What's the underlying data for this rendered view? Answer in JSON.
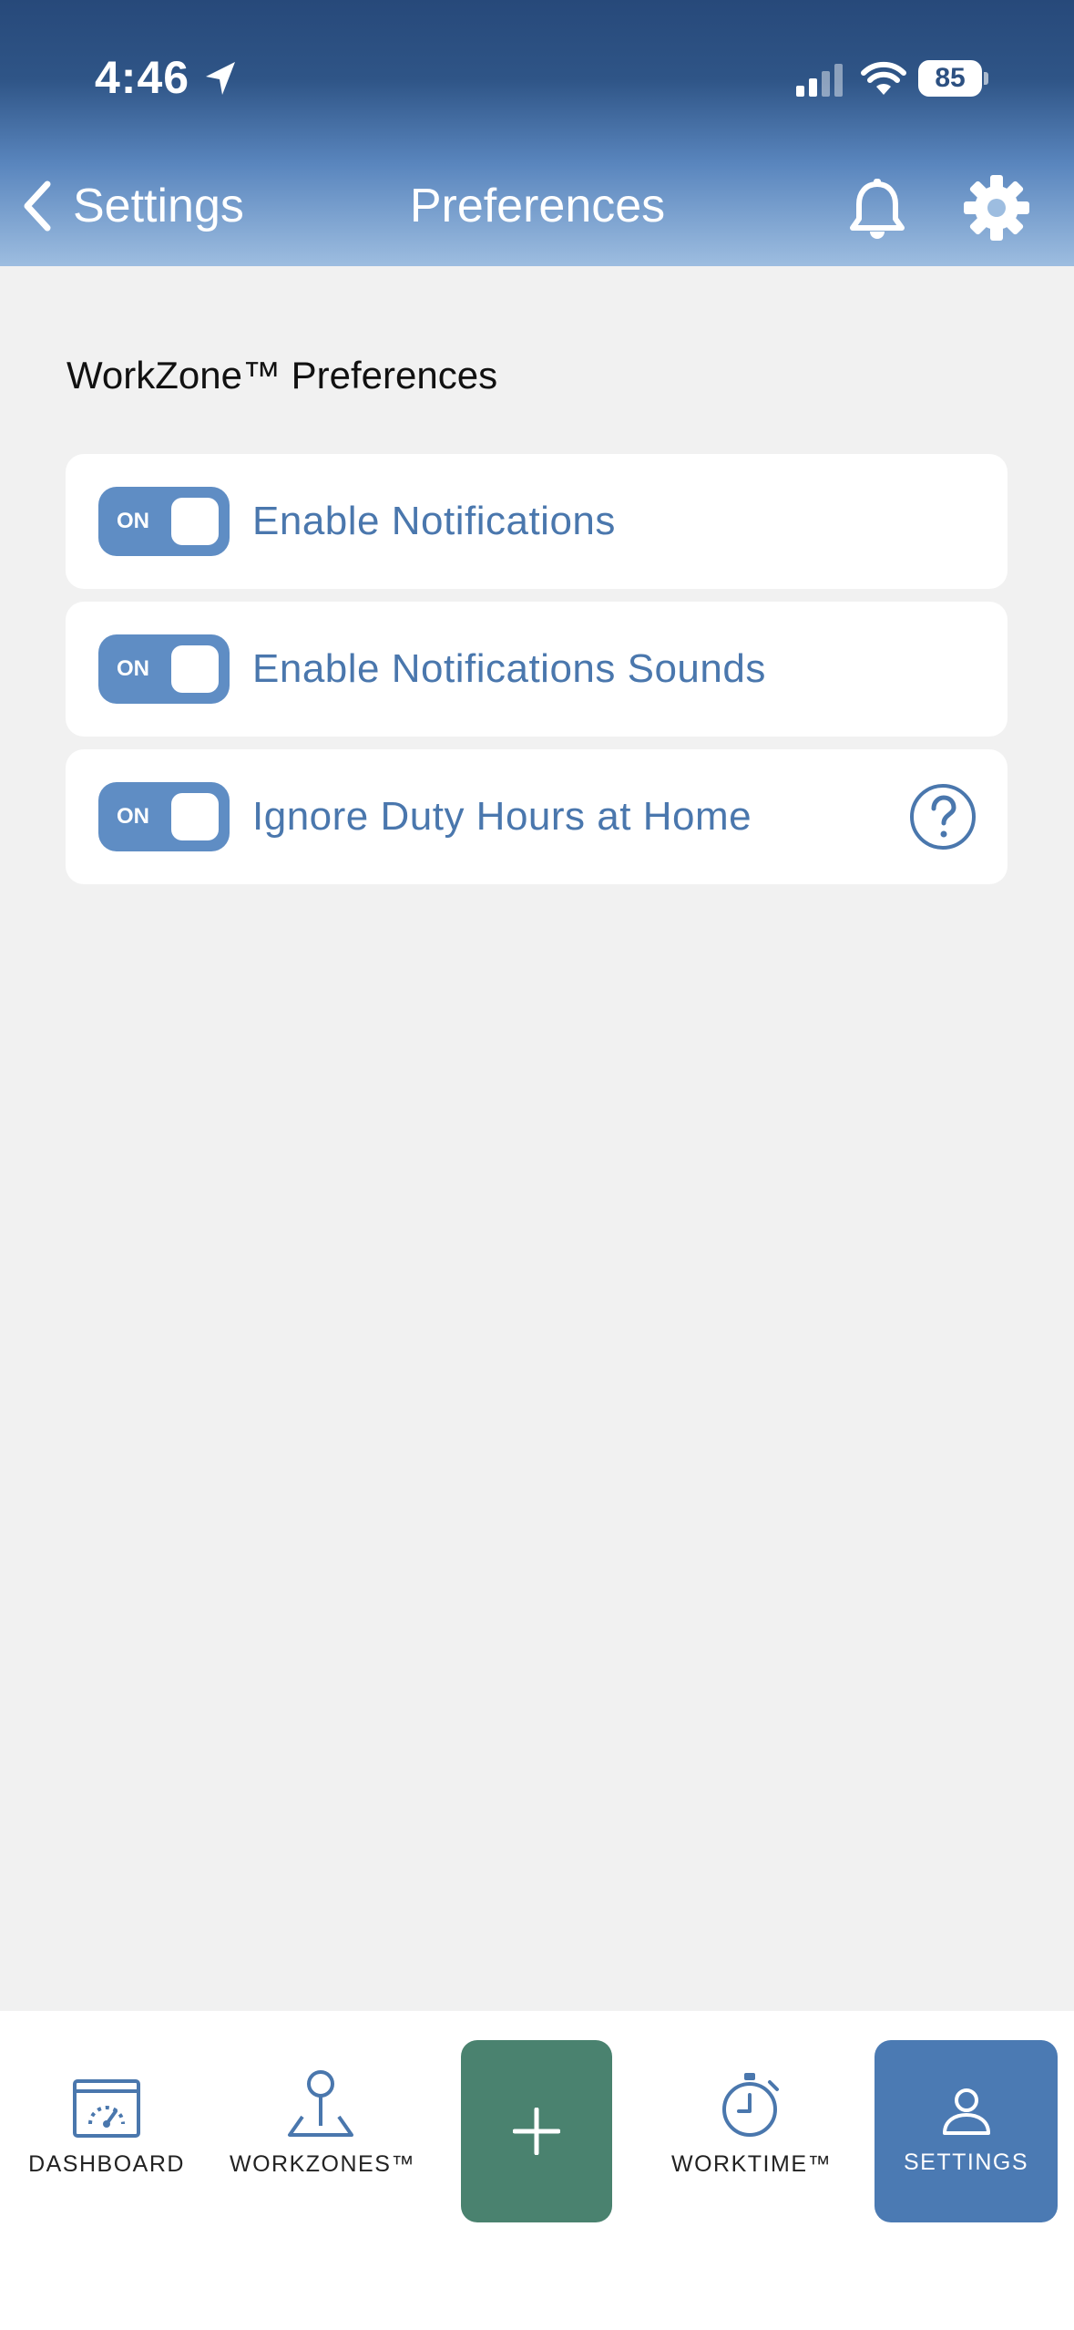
{
  "status_bar": {
    "time": "4:46",
    "battery": "85",
    "icons": [
      "location-arrow-icon",
      "signal-icon",
      "wifi-icon",
      "battery-icon"
    ]
  },
  "nav": {
    "back_label": "Settings",
    "title": "Preferences",
    "icons": [
      "chevron-left-icon",
      "bell-icon",
      "gear-icon"
    ]
  },
  "section": {
    "title": "WorkZone™ Preferences"
  },
  "preferences": [
    {
      "label": "Enable Notifications",
      "toggle": "ON",
      "enabled": true
    },
    {
      "label": "Enable Notifications Sounds",
      "toggle": "ON",
      "enabled": true
    },
    {
      "label": "Ignore Duty Hours at Home",
      "toggle": "ON",
      "enabled": true,
      "help_icon": "question-circle-icon"
    }
  ],
  "tabs": [
    {
      "label": "DASHBOARD",
      "icon": "dashboard-icon"
    },
    {
      "label": "WORKZONES™",
      "icon": "map-pin-icon"
    },
    {
      "label": "",
      "icon": "plus-icon"
    },
    {
      "label": "WORKTIME™",
      "icon": "stopwatch-icon"
    },
    {
      "label": "SETTINGS",
      "icon": "user-icon",
      "active": true
    }
  ],
  "colors": {
    "header_top": "#27497a",
    "header_bottom": "#9dbde0",
    "accent_blue": "#4b7ab3",
    "toggle_on": "#5f8dc4",
    "label_blue": "#4a77ad",
    "add_button": "#4a826f",
    "background": "#f1f1f1"
  }
}
